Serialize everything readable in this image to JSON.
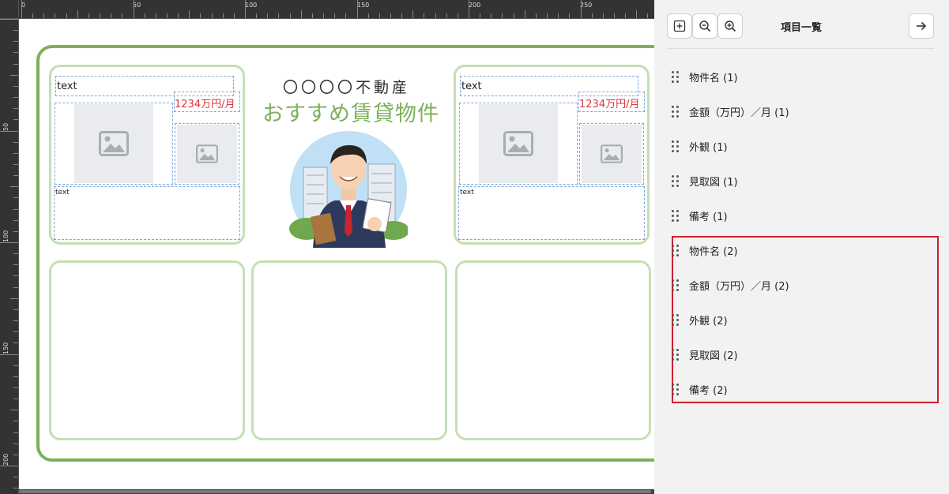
{
  "ruler": {
    "top_labels": [
      "0",
      "50",
      "100",
      "150",
      "200",
      "250"
    ],
    "left_labels": [
      "50",
      "100",
      "150",
      "200"
    ]
  },
  "flyer": {
    "title_line1": "〇〇〇〇不動産",
    "title_line2": "おすすめ賃貸物件",
    "card_left": {
      "name_text": "text",
      "price_text": "1234万円/月",
      "notes_text": "text"
    },
    "card_right": {
      "name_text": "text",
      "price_text": "1234万円/月",
      "notes_text": "text"
    }
  },
  "panel": {
    "title": "項目一覧",
    "items": [
      {
        "label": "物件名 (1)"
      },
      {
        "label": "金額（万円）／月 (1)"
      },
      {
        "label": "外観 (1)"
      },
      {
        "label": "見取図 (1)"
      },
      {
        "label": "備考 (1)"
      },
      {
        "label": "物件名 (2)"
      },
      {
        "label": "金額（万円）／月 (2)"
      },
      {
        "label": "外観 (2)"
      },
      {
        "label": "見取図 (2)"
      },
      {
        "label": "備考 (2)"
      }
    ]
  },
  "colors": {
    "accent_green": "#7cb05a",
    "light_green": "#c5dfb3",
    "price_red": "#d9363e",
    "highlight_red": "#d0202c"
  }
}
